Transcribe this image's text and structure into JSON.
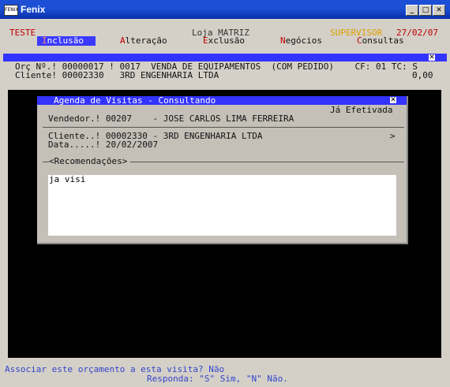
{
  "window": {
    "title": "Fenix",
    "icon_text": "FENIX"
  },
  "status": {
    "left": "TESTE",
    "store": "Loja MATRIZ",
    "user": "SUPERVISOR",
    "date": "27/02/07"
  },
  "menu": [
    {
      "hot": "I",
      "rest": "nclusão",
      "selected": true
    },
    {
      "hot": "A",
      "rest": "lteração"
    },
    {
      "hot": "E",
      "rest": "xclusão"
    },
    {
      "hot": "N",
      "rest": "egócios"
    },
    {
      "hot": "C",
      "rest": "onsultas"
    }
  ],
  "order": {
    "line1": "Orç Nº.! 00000017 ! 0017  VENDA DE EQUIPAMENTOS  (COM PEDIDO)    CF: 01 TC: S",
    "line2_left": "Cliente! 00002330   3RD ENGENHARIA LTDA",
    "line2_right": "0,00"
  },
  "dialog": {
    "title": "Agenda de Visitas - Consultando",
    "status": "Já Efetivada",
    "vendedor": "Vendedor.! 00207    - JOSE CARLOS LIMA FERREIRA",
    "cliente": "Cliente..! 00002330 - 3RD ENGENHARIA LTDA",
    "cliente_arrow": ">",
    "data": "Data.....! 20/02/2007",
    "recomendacoes_label": "<Recomendações>",
    "recomendacoes_text": "ja visi"
  },
  "prompt": {
    "question": "Associar este orçamento a esta visita? Não",
    "answer_hint": "Responda: \"S\" Sim, \"N\" Não."
  },
  "colors": {
    "menu_hotkey": "#c00000",
    "highlight": "#3a3aff",
    "user_color": "#e0a000",
    "prompt_color": "#3344cc"
  }
}
